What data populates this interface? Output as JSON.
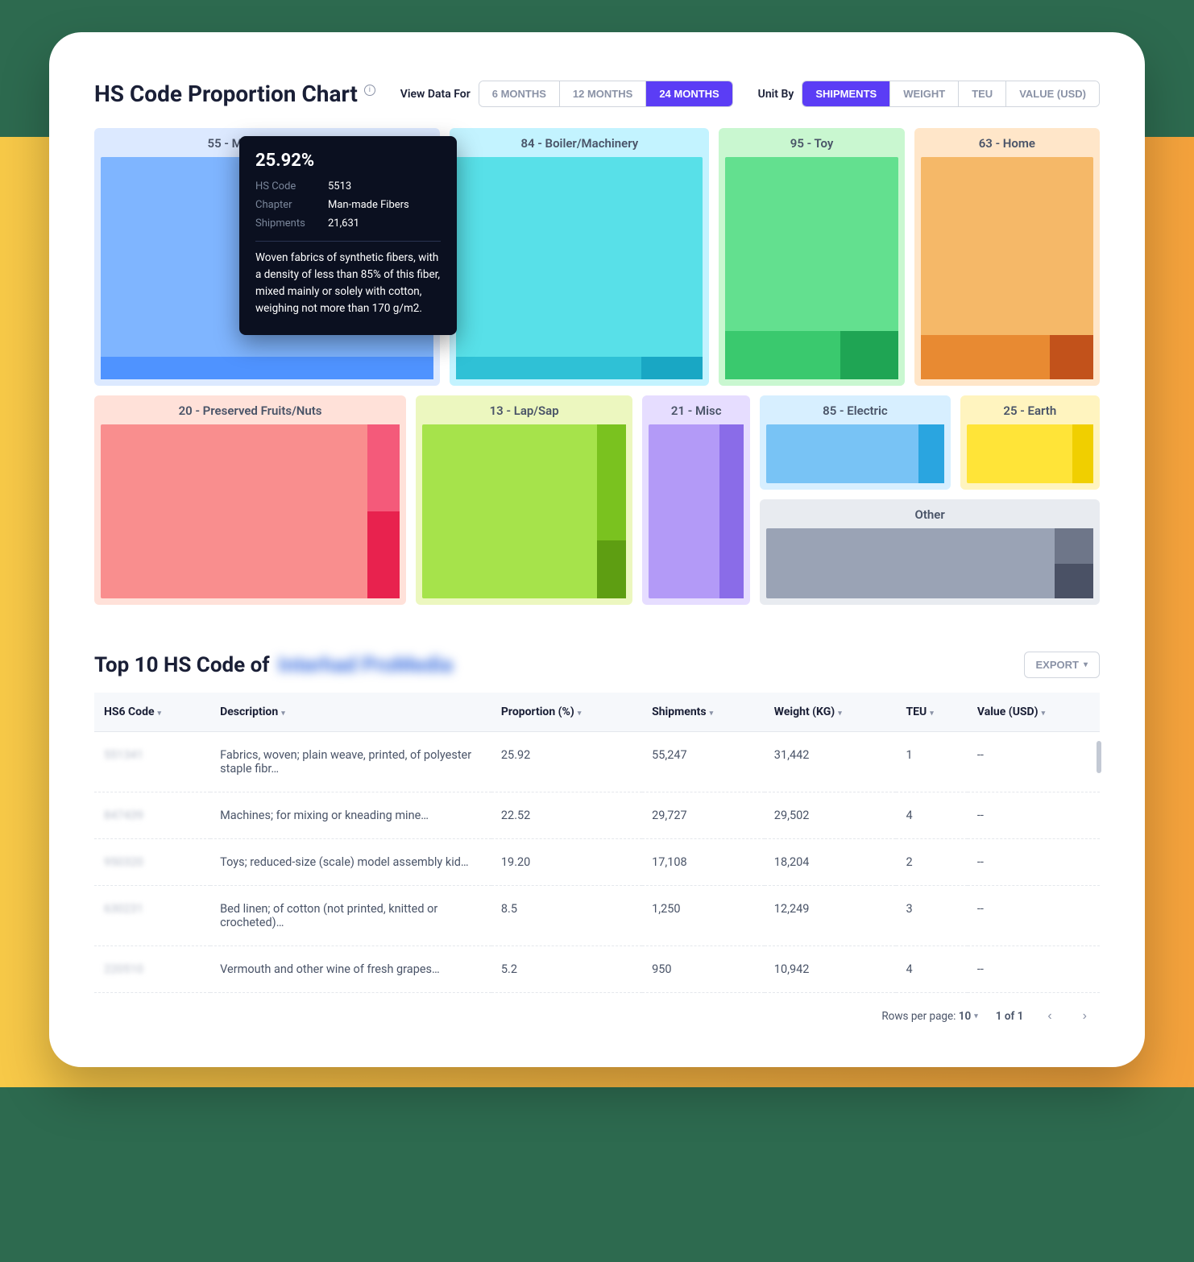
{
  "header": {
    "title": "HS Code Proportion Chart",
    "view_label": "View Data For",
    "view_options": [
      "6 MONTHS",
      "12 MONTHS",
      "24 MONTHS"
    ],
    "view_active_index": 2,
    "unit_label": "Unit By",
    "unit_options": [
      "SHIPMENTS",
      "WEIGHT",
      "TEU",
      "VALUE (USD)"
    ],
    "unit_active_index": 0
  },
  "tooltip": {
    "percent": "25.92%",
    "rows": [
      {
        "k": "HS Code",
        "v": "5513"
      },
      {
        "k": "Chapter",
        "v": "Man-made Fibers"
      },
      {
        "k": "Shipments",
        "v": "21,631"
      }
    ],
    "description": "Woven fabrics of synthetic fibers, with a density of less than 85% of this fiber, mixed mainly or solely with cotton, weighing not more than 170 g/m2."
  },
  "chart_data": {
    "type": "treemap",
    "title": "HS Code Proportion Chart",
    "unit": "Shipments",
    "period": "24 MONTHS",
    "nodes": [
      {
        "code": "55",
        "label": "55 - Man-made Fibers",
        "proportion_pct": 25.92,
        "shipments": 21631,
        "color_frame": "#dce9ff",
        "color_body": "#7fb5ff",
        "sub_colors": [
          "#4f93ff"
        ]
      },
      {
        "code": "84",
        "label": "84 - Boiler/Machinery",
        "proportion_pct": 22.52,
        "shipments": 29727,
        "color_frame": "#c3f3ff",
        "color_body": "#58e0e8",
        "sub_colors": [
          "#2fc1d6",
          "#19a7c4"
        ]
      },
      {
        "code": "95",
        "label": "95 - Toy",
        "proportion_pct": 19.2,
        "shipments": 17108,
        "color_frame": "#c9f7d0",
        "color_body": "#63e08f",
        "sub_colors": [
          "#3ac96e",
          "#1fa554"
        ]
      },
      {
        "code": "63",
        "label": "63 - Home",
        "proportion_pct": 8.5,
        "shipments": 1250,
        "color_frame": "#ffe6c9",
        "color_body": "#f5b868",
        "sub_colors": [
          "#e88a32",
          "#c2521b"
        ]
      },
      {
        "code": "20",
        "label": "20 - Preserved Fruits/Nuts",
        "proportion_pct": 5.2,
        "shipments": 950,
        "color_frame": "#ffe1d9",
        "color_body": "#f98e8e",
        "sub_colors": [
          "#f45a7a",
          "#e8224e"
        ]
      },
      {
        "code": "13",
        "label": "13 - Lap/Sap",
        "color_frame": "#ecf7bf",
        "color_body": "#a6e34b",
        "sub_colors": [
          "#7ac21f",
          "#5e9e12"
        ]
      },
      {
        "code": "21",
        "label": "21 - Misc",
        "color_frame": "#e6ddff",
        "color_body": "#b39af7",
        "sub_colors": [
          "#8a6ce8"
        ]
      },
      {
        "code": "85",
        "label": "85 - Electric",
        "color_frame": "#d7efff",
        "color_body": "#78c3f5",
        "sub_colors": [
          "#2aa5e0"
        ]
      },
      {
        "code": "25",
        "label": "25 - Earth",
        "color_frame": "#fff4bf",
        "color_body": "#ffe438",
        "sub_colors": [
          "#f0cf00"
        ]
      },
      {
        "code": "other",
        "label": "Other",
        "color_frame": "#e8ebf0",
        "color_body": "#9aa3b5",
        "sub_colors": [
          "#6e7689",
          "#4a5165"
        ]
      }
    ]
  },
  "table": {
    "title_prefix": "Top 10 HS Code of",
    "title_subject_blurred": "Interhad ProMedia",
    "export_label": "EXPORT",
    "columns": [
      "HS6 Code",
      "Description",
      "Proportion (%)",
      "Shipments",
      "Weight (KG)",
      "TEU",
      "Value (USD)"
    ],
    "rows": [
      {
        "code": "551341",
        "desc": "Fabrics, woven; plain weave, printed, of polyester staple fibr…",
        "proportion": "25.92",
        "shipments": "55,247",
        "weight": "31,442",
        "teu": "1",
        "value": "--"
      },
      {
        "code": "847439",
        "desc": "Machines; for mixing or kneading mine…",
        "proportion": "22.52",
        "shipments": "29,727",
        "weight": "29,502",
        "teu": "4",
        "value": "--"
      },
      {
        "code": "950320",
        "desc": "Toys; reduced-size (scale) model assembly kid…",
        "proportion": "19.20",
        "shipments": "17,108",
        "weight": "18,204",
        "teu": "2",
        "value": "--"
      },
      {
        "code": "630231",
        "desc": "Bed linen; of cotton (not printed, knitted or crocheted)…",
        "proportion": "8.5",
        "shipments": "1,250",
        "weight": "12,249",
        "teu": "3",
        "value": "--"
      },
      {
        "code": "220510",
        "desc": "Vermouth and other wine of fresh grapes…",
        "proportion": "5.2",
        "shipments": "950",
        "weight": "10,942",
        "teu": "4",
        "value": "--"
      }
    ]
  },
  "pagination": {
    "rows_label": "Rows per page:",
    "rows_value": "10",
    "page_status": "1 of 1"
  }
}
